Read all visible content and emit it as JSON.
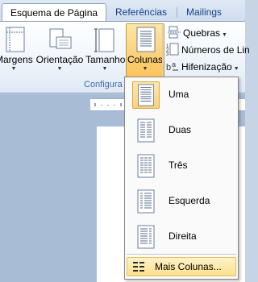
{
  "tabs": [
    {
      "label": "Esquema de Página",
      "active": true
    },
    {
      "label": "Referências",
      "active": false
    },
    {
      "label": "Mailings",
      "active": false
    }
  ],
  "ribbon": {
    "buttons": {
      "margins": "Margens",
      "orientation": "Orientação",
      "size": "Tamanho",
      "columns": "Colunas"
    },
    "small_buttons": {
      "breaks": "Quebras",
      "line_numbers": "Números de Lin",
      "hyphenation": "Hifenização"
    },
    "group_label": "Configura"
  },
  "columns_menu": {
    "items": [
      {
        "label": "Uma",
        "icon": "one-column-icon",
        "selected": true
      },
      {
        "label": "Duas",
        "icon": "two-columns-icon",
        "selected": false
      },
      {
        "label": "Três",
        "icon": "three-columns-icon",
        "selected": false
      },
      {
        "label": "Esquerda",
        "icon": "left-column-icon",
        "selected": false
      },
      {
        "label": "Direita",
        "icon": "right-column-icon",
        "selected": false
      }
    ],
    "more": "Mais Colunas..."
  },
  "colors": {
    "accent_pressed": "#f9c35b",
    "ribbon_text": "#15428b",
    "group_label": "#3e6aaa"
  }
}
